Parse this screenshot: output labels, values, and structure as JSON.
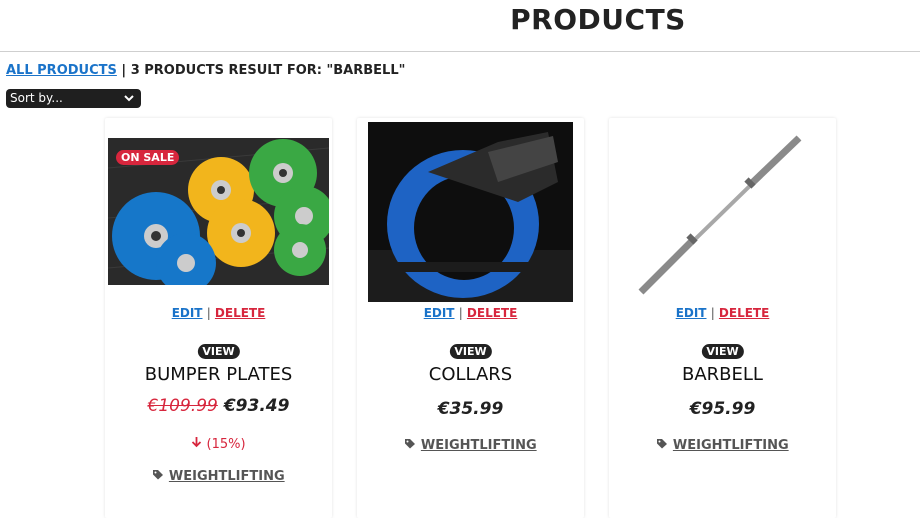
{
  "header": {
    "title": "PRODUCTS"
  },
  "breadcrumb": {
    "all_products": "ALL PRODUCTS",
    "separator": "|",
    "result_text": "3 PRODUCTS RESULT FOR: \"BARBELL\""
  },
  "sort": {
    "selected": "Sort by..."
  },
  "actions": {
    "edit": "EDIT",
    "separator": "|",
    "delete": "DELETE",
    "view": "VIEW"
  },
  "products": [
    {
      "name": "BUMPER PLATES",
      "badge": "ON SALE",
      "old_price": "€109.99",
      "price": "€93.49",
      "discount": "(15%)",
      "category": "WEIGHTLIFTING"
    },
    {
      "name": "COLLARS",
      "price": "€35.99",
      "category": "WEIGHTLIFTING"
    },
    {
      "name": "BARBELL",
      "price": "€95.99",
      "category": "WEIGHTLIFTING"
    }
  ],
  "colors": {
    "link": "#1a73c9",
    "danger": "#d7263d",
    "dark": "#222222"
  }
}
